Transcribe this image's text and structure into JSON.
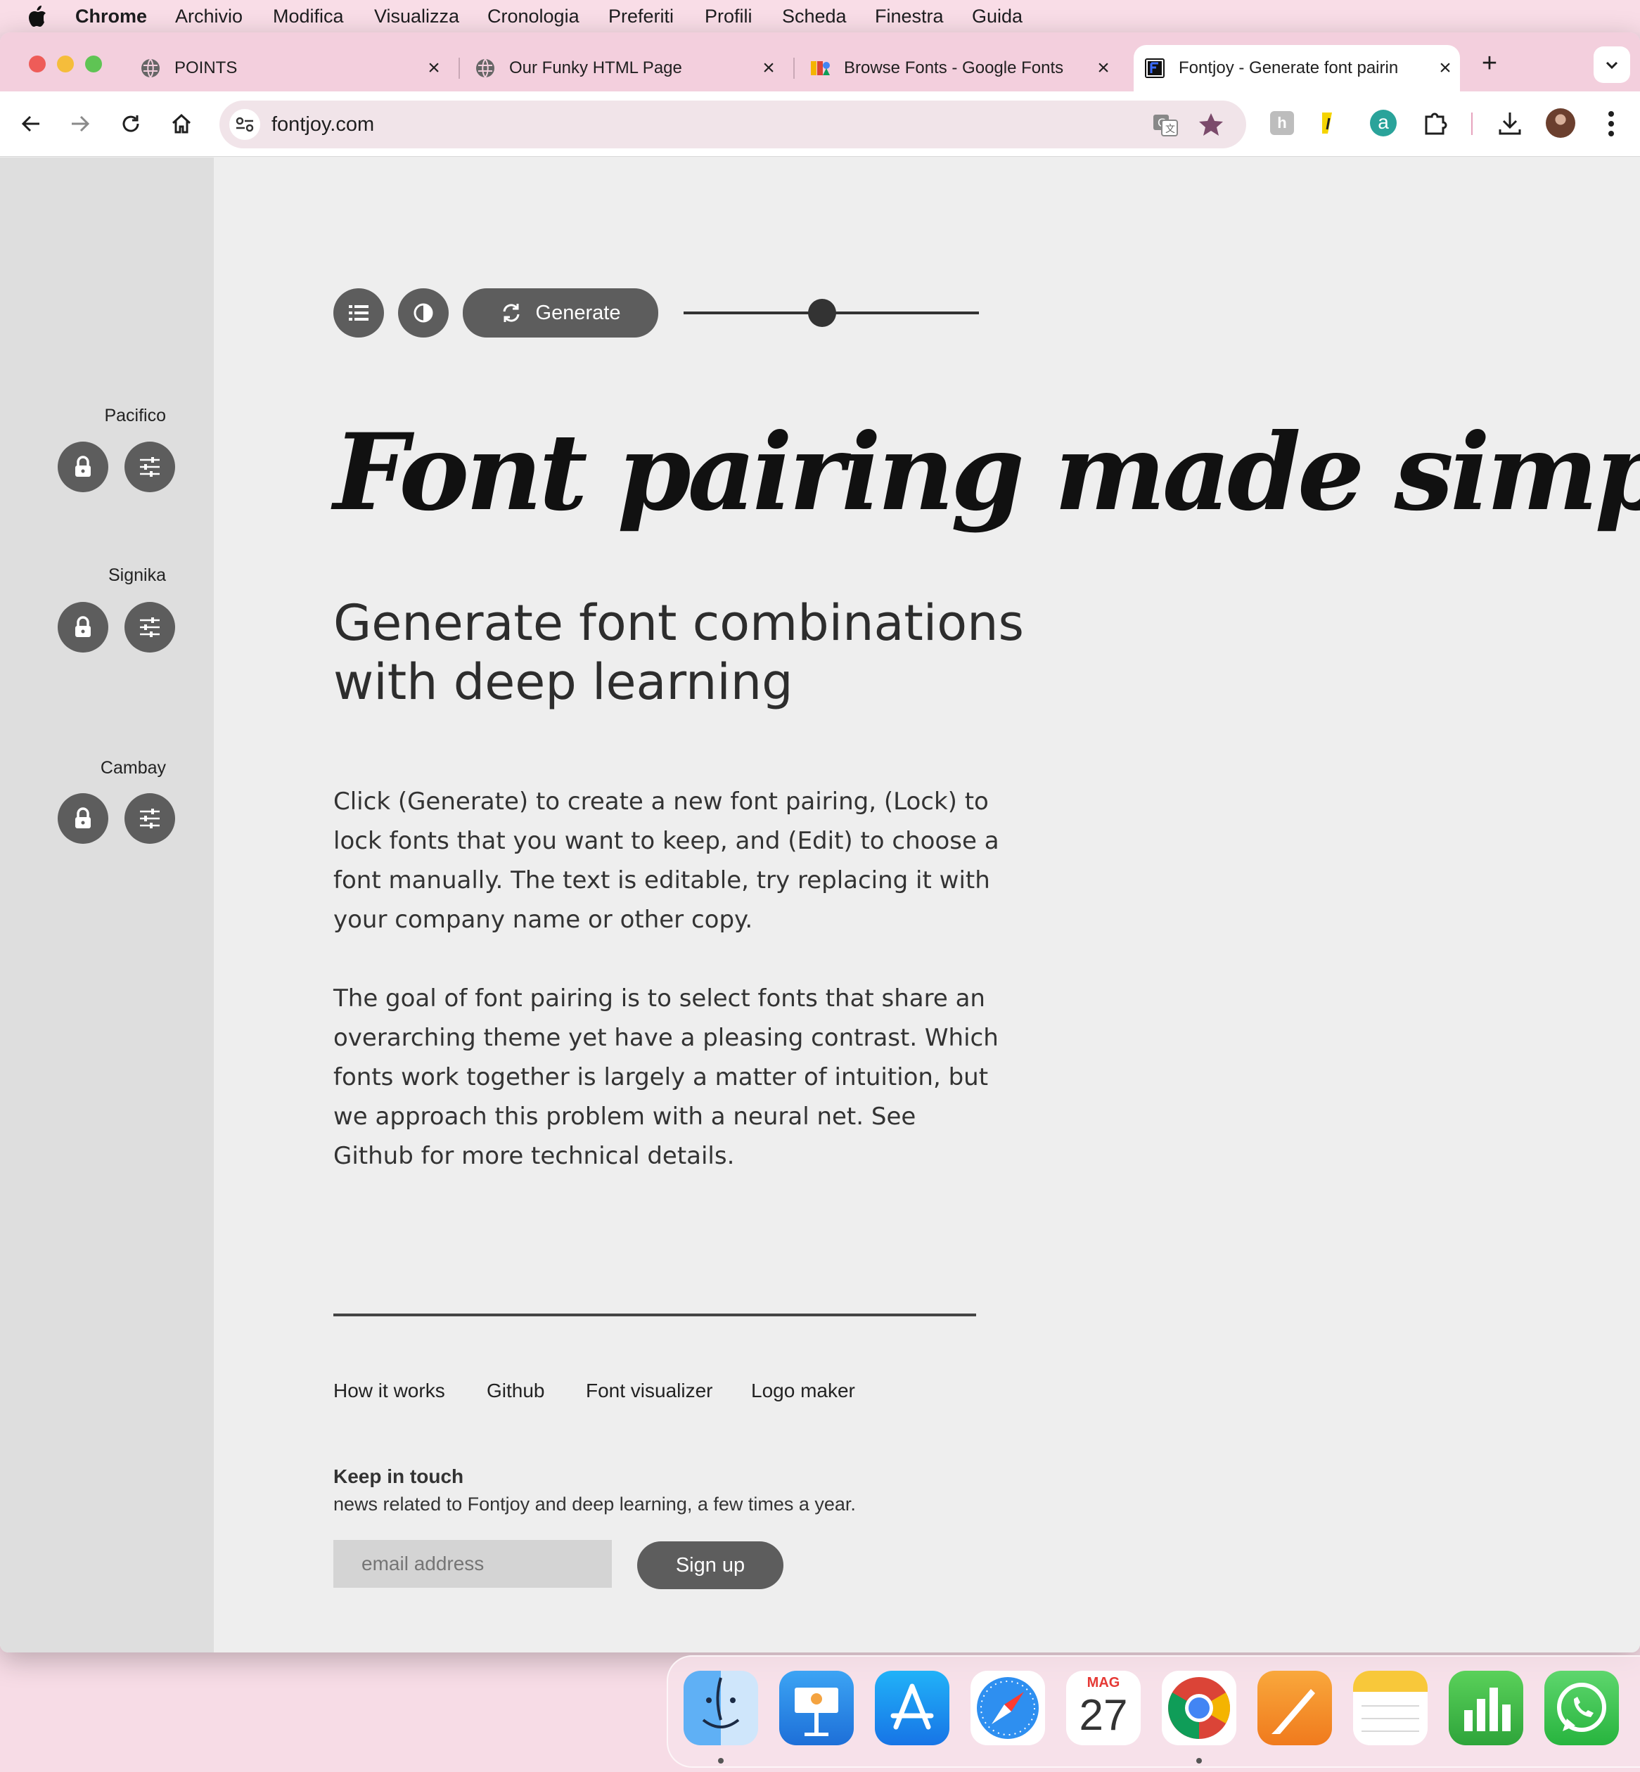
{
  "menubar": {
    "app": "Chrome",
    "items": [
      "Archivio",
      "Modifica",
      "Visualizza",
      "Cronologia",
      "Preferiti",
      "Profili",
      "Scheda",
      "Finestra",
      "Guida"
    ]
  },
  "tabs": [
    {
      "title": "POINTS",
      "icon": "globe-icon"
    },
    {
      "title": "Our Funky HTML Page",
      "icon": "globe-icon"
    },
    {
      "title": "Browse Fonts - Google Fonts",
      "icon": "google-fonts-icon"
    },
    {
      "title": "Fontjoy - Generate font pairin",
      "icon": "fontjoy-icon",
      "active": true
    }
  ],
  "browser": {
    "url": "fontjoy.com",
    "accent": "#7b4a6b"
  },
  "toolbar": {
    "generate_label": "Generate",
    "slider_value": 0.47
  },
  "fonts": [
    {
      "name": "Pacifico"
    },
    {
      "name": "Signika"
    },
    {
      "name": "Cambay"
    }
  ],
  "content": {
    "heading": "Font pairing made simple",
    "subheading": "Generate font combinations with deep learning",
    "paragraph1": "Click (Generate) to create a new font pairing, (Lock) to lock fonts that you want to keep, and (Edit) to choose a font manually. The text is editable, try replacing it with your company name or other copy.",
    "paragraph2": "The goal of font pairing is to select fonts that share an overarching theme yet have a pleasing contrast. Which fonts work together is largely a matter of intuition, but we approach this problem with a neural net. See Github for more technical details."
  },
  "footer": {
    "links": [
      "How it works",
      "Github",
      "Font visualizer",
      "Logo maker"
    ],
    "keep_title": "Keep in touch",
    "keep_desc": "news related to Fontjoy and deep learning, a few times a year.",
    "email_placeholder": "email address",
    "signup_label": "Sign up"
  },
  "dock": {
    "calendar_month": "MAG",
    "calendar_day": "27",
    "apps": [
      "finder-icon",
      "keynote-icon",
      "app-store-icon",
      "safari-icon",
      "calendar-icon",
      "chrome-icon",
      "pages-icon",
      "notes-icon",
      "numbers-icon",
      "whatsapp-icon"
    ]
  }
}
